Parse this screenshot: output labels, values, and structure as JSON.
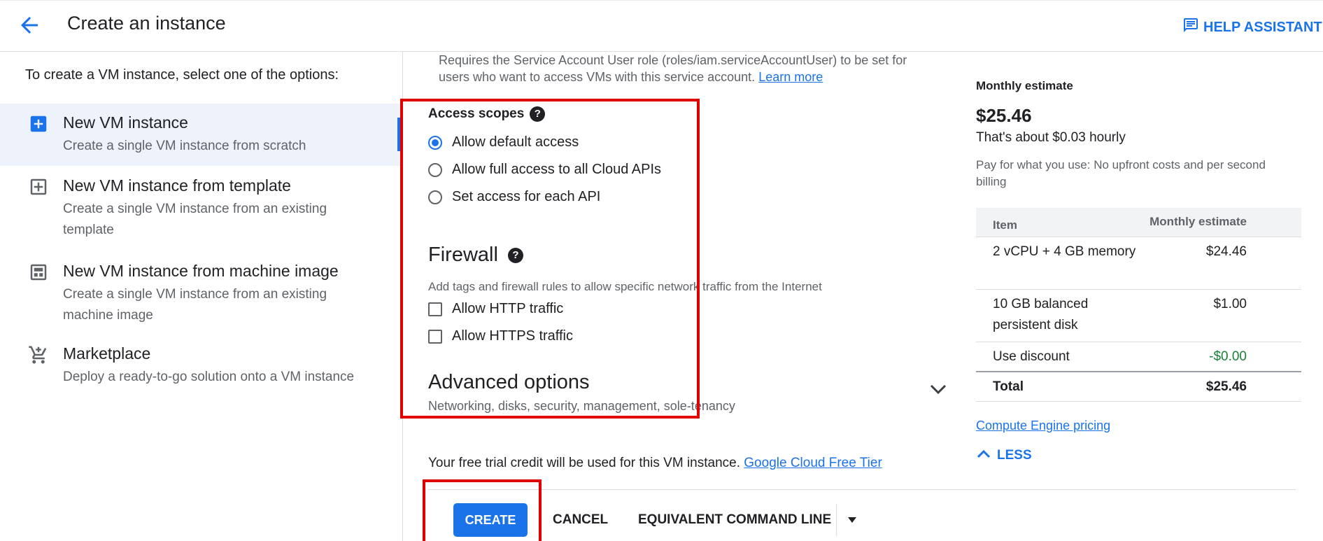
{
  "header": {
    "title": "Create an instance",
    "help_label": "HELP ASSISTANT",
    "back_icon": "arrow-back-icon",
    "help_icon": "feedback-icon"
  },
  "left": {
    "intro": "To create a VM instance, select one of the options:",
    "options": [
      {
        "title": "New VM instance",
        "desc": "Create a single VM instance from scratch",
        "icon": "add-box-icon",
        "selected": true
      },
      {
        "title": "New VM instance from template",
        "desc": "Create a single VM instance from an existing template",
        "icon": "template-icon",
        "selected": false
      },
      {
        "title": "New VM instance from machine image",
        "desc": "Create a single VM instance from an existing machine image",
        "icon": "machine-image-icon",
        "selected": false
      },
      {
        "title": "Marketplace",
        "desc": "Deploy a ready-to-go solution onto a VM instance",
        "icon": "cart-icon",
        "selected": false
      }
    ]
  },
  "main": {
    "service_note": "Requires the Service Account User role (roles/iam.serviceAccountUser) to be set for users who want to access VMs with this service account.",
    "learn_more": "Learn more",
    "access_scopes": {
      "label": "Access scopes",
      "options": [
        {
          "label": "Allow default access",
          "checked": true
        },
        {
          "label": "Allow full access to all Cloud APIs",
          "checked": false
        },
        {
          "label": "Set access for each API",
          "checked": false
        }
      ]
    },
    "firewall": {
      "title": "Firewall",
      "desc": "Add tags and firewall rules to allow specific network traffic from the Internet",
      "options": [
        {
          "label": "Allow HTTP traffic",
          "checked": false
        },
        {
          "label": "Allow HTTPS traffic",
          "checked": false
        }
      ]
    },
    "advanced": {
      "title": "Advanced options",
      "desc": "Networking, disks, security, management, sole-tenancy"
    },
    "trial_text": "Your free trial credit will be used for this VM instance.",
    "free_tier_link": "Google Cloud Free Tier",
    "actions": {
      "create": "CREATE",
      "cancel": "CANCEL",
      "equivalent": "EQUIVALENT COMMAND LINE"
    }
  },
  "estimate": {
    "label": "Monthly estimate",
    "price": "$25.46",
    "hourly": "That's about $0.03 hourly",
    "note": "Pay for what you use: No upfront costs and per second billing",
    "table": {
      "headers": [
        "Item",
        "Monthly estimate"
      ],
      "rows": [
        {
          "item": "2 vCPU + 4 GB memory",
          "cost": "$24.46"
        },
        {
          "item": "10 GB balanced persistent disk",
          "cost": "$1.00"
        },
        {
          "item": "Use discount",
          "cost": "-$0.00"
        },
        {
          "item": "Total",
          "cost": "$25.46"
        }
      ]
    },
    "pricing_link": "Compute Engine pricing",
    "less_label": "LESS"
  },
  "colors": {
    "accent": "#1a73e8",
    "highlight_box": "#e00000",
    "discount": "#188038"
  }
}
